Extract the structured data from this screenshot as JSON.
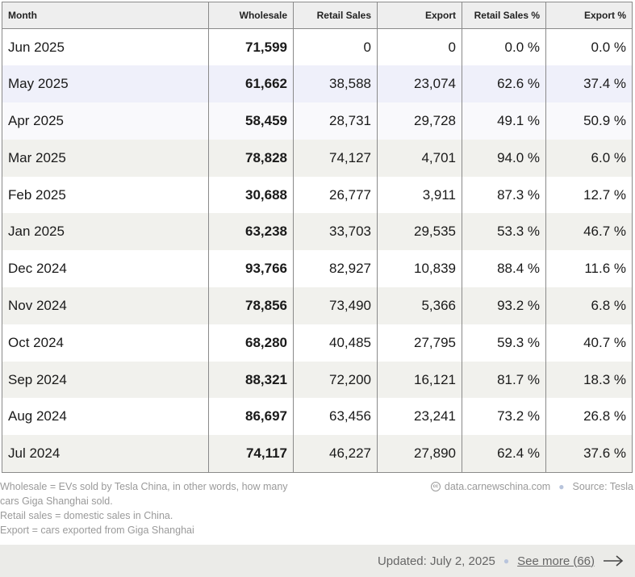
{
  "table": {
    "headers": [
      "Month",
      "Wholesale",
      "Retail Sales",
      "Export",
      "Retail Sales %",
      "Export %"
    ],
    "rows": [
      [
        "Jun 2025",
        "71,599",
        "0",
        "0",
        "0.0 %",
        "0.0 %"
      ],
      [
        "May 2025",
        "61,662",
        "38,588",
        "23,074",
        "62.6 %",
        "37.4 %"
      ],
      [
        "Apr 2025",
        "58,459",
        "28,731",
        "29,728",
        "49.1 %",
        "50.9 %"
      ],
      [
        "Mar 2025",
        "78,828",
        "74,127",
        "4,701",
        "94.0 %",
        "6.0 %"
      ],
      [
        "Feb 2025",
        "30,688",
        "26,777",
        "3,911",
        "87.3 %",
        "12.7 %"
      ],
      [
        "Jan 2025",
        "63,238",
        "33,703",
        "29,535",
        "53.3 %",
        "46.7 %"
      ],
      [
        "Dec 2024",
        "93,766",
        "82,927",
        "10,839",
        "88.4 %",
        "11.6 %"
      ],
      [
        "Nov 2024",
        "78,856",
        "73,490",
        "5,366",
        "93.2 %",
        "6.8 %"
      ],
      [
        "Oct 2024",
        "68,280",
        "40,485",
        "27,795",
        "59.3 %",
        "40.7 %"
      ],
      [
        "Sep 2024",
        "88,321",
        "72,200",
        "16,121",
        "81.7 %",
        "18.3 %"
      ],
      [
        "Aug 2024",
        "86,697",
        "63,456",
        "23,241",
        "73.2 %",
        "26.8 %"
      ],
      [
        "Jul 2024",
        "74,117",
        "46,227",
        "27,890",
        "62.4 %",
        "37.6 %"
      ]
    ],
    "row_backgrounds": [
      "#ffffff",
      "#eff0fa",
      "#f9f9fc",
      "#f1f1ed",
      "#ffffff",
      "#f1f1ed",
      "#ffffff",
      "#f1f1ed",
      "#ffffff",
      "#f1f1ed",
      "#ffffff",
      "#f1f1ed"
    ]
  },
  "notes": {
    "line1": "Wholesale = EVs sold by Tesla China, in other words, how many cars Giga Shanghai sold.",
    "line2": "Retail sales = domestic sales in China.",
    "line3": "Export = cars exported from Giga Shanghai"
  },
  "source": {
    "icon": "creative-commons-icon",
    "site": "data.carnewschina.com",
    "label": "Source: Tesla"
  },
  "footer": {
    "updated": "Updated: July 2, 2025",
    "see_more": "See more (66)",
    "arrow_icon": "arrow-right-icon"
  }
}
